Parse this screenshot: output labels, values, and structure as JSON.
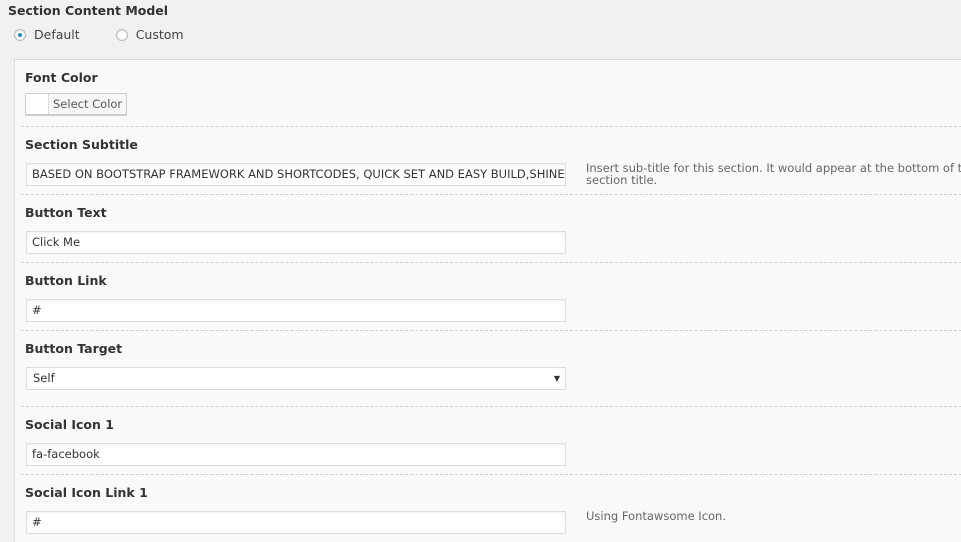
{
  "section_model": {
    "title": "Section Content Model",
    "options": [
      {
        "label": "Default",
        "checked": true
      },
      {
        "label": "Custom",
        "checked": false
      }
    ]
  },
  "fields": {
    "font_color": {
      "label": "Font Color",
      "button_label": "Select Color",
      "swatch_color": "#ffffff"
    },
    "section_subtitle": {
      "label": "Section Subtitle",
      "value": "BASED ON BOOTSTRAP FRAMEWORK AND SHORTCODES, QUICK SET AND EASY BUILD,SHINES ONE PAGE SMALL BUSINESS WORDPRESS THEME",
      "help_line1": "Insert sub-title for this section. It would appear at the bottom of the",
      "help_line2": "section title."
    },
    "button_text": {
      "label": "Button Text",
      "value": "Click Me"
    },
    "button_link": {
      "label": "Button Link",
      "value": "#"
    },
    "button_target": {
      "label": "Button Target",
      "selected": "Self"
    },
    "social_icon_1": {
      "label": "Social Icon 1",
      "value": "fa-facebook"
    },
    "social_icon_link_1": {
      "label": "Social Icon Link 1",
      "value": "#",
      "help": "Using Fontawsome Icon."
    }
  },
  "colors": {
    "page_background": "#f1f1f1",
    "panel_background": "#f9f9f9",
    "radio_accent": "#1e8cbe"
  }
}
